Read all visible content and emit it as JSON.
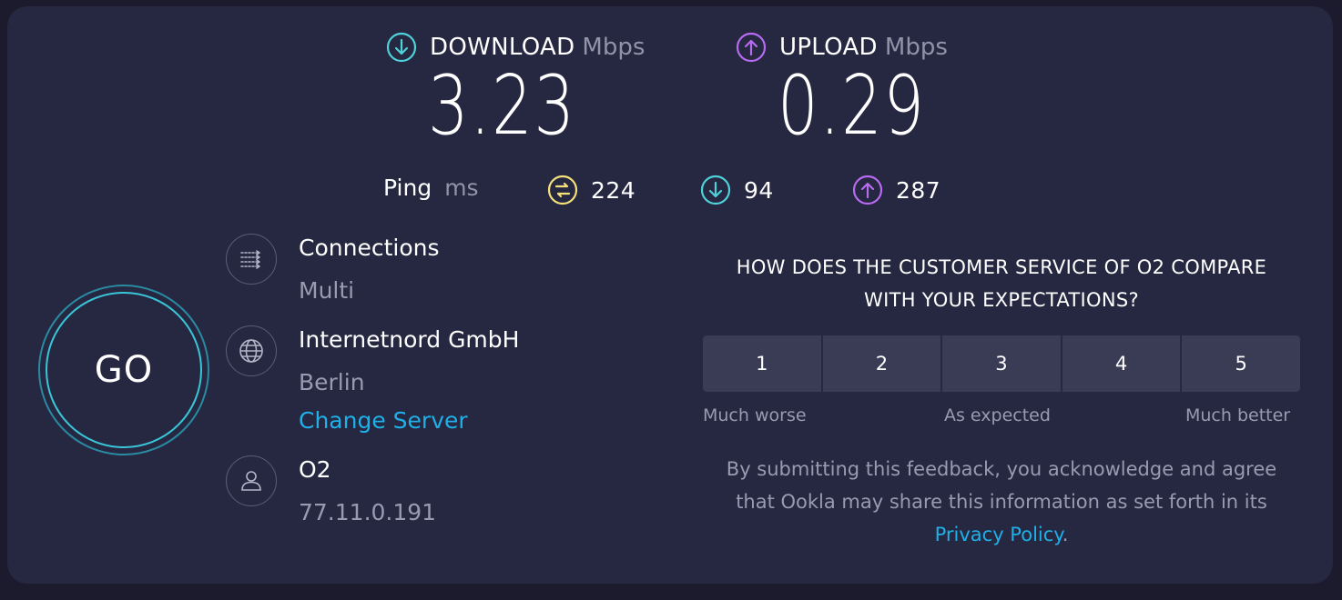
{
  "download": {
    "title": "DOWNLOAD",
    "unit": "Mbps",
    "value": "3.23",
    "icon": "arrow-down-circle-icon",
    "color": "#4fd1d9"
  },
  "upload": {
    "title": "UPLOAD",
    "unit": "Mbps",
    "value": "0.29",
    "icon": "arrow-up-circle-icon",
    "color": "#b76bf0"
  },
  "ping": {
    "label": "Ping",
    "unit": "ms",
    "idle": {
      "value": "224",
      "icon": "idle-latency-icon",
      "color": "#f5e17a"
    },
    "download": {
      "value": "94",
      "icon": "arrow-down-circle-icon",
      "color": "#4fd1d9"
    },
    "upload": {
      "value": "287",
      "icon": "arrow-up-circle-icon",
      "color": "#b76bf0"
    }
  },
  "go_button": {
    "label": "GO"
  },
  "connections": {
    "title": "Connections",
    "value": "Multi",
    "icon": "connections-icon"
  },
  "server": {
    "name": "Internetnord GmbH",
    "location": "Berlin",
    "change_label": "Change Server",
    "icon": "globe-icon"
  },
  "provider": {
    "name": "O2",
    "ip": "77.11.0.191",
    "icon": "user-icon"
  },
  "survey": {
    "question_line1": "HOW DOES THE CUSTOMER SERVICE OF O2 COMPARE",
    "question_line2": "WITH YOUR EXPECTATIONS?",
    "ratings": [
      "1",
      "2",
      "3",
      "4",
      "5"
    ],
    "low_label": "Much worse",
    "mid_label": "As expected",
    "high_label": "Much better",
    "disclaimer_line1": "By submitting this feedback, you acknowledge and agree",
    "disclaimer_line2": "that Ookla may share this information as set forth in its",
    "privacy_link": "Privacy Policy",
    "period": "."
  }
}
